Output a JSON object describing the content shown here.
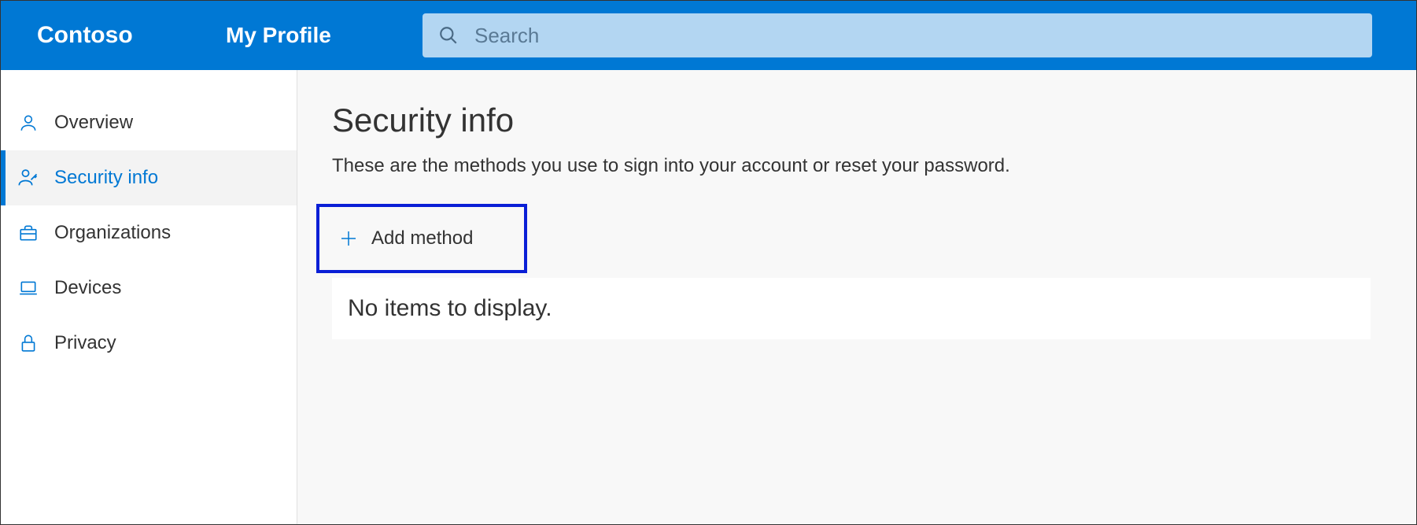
{
  "header": {
    "brand": "Contoso",
    "section": "My Profile",
    "search_placeholder": "Search"
  },
  "sidebar": {
    "items": [
      {
        "label": "Overview",
        "icon": "person-icon",
        "active": false
      },
      {
        "label": "Security info",
        "icon": "key-person-icon",
        "active": true
      },
      {
        "label": "Organizations",
        "icon": "briefcase-icon",
        "active": false
      },
      {
        "label": "Devices",
        "icon": "laptop-icon",
        "active": false
      },
      {
        "label": "Privacy",
        "icon": "lock-icon",
        "active": false
      }
    ]
  },
  "main": {
    "title": "Security info",
    "subtitle": "These are the methods you use to sign into your account or reset your password.",
    "add_method_label": "Add method",
    "empty_message": "No items to display."
  }
}
